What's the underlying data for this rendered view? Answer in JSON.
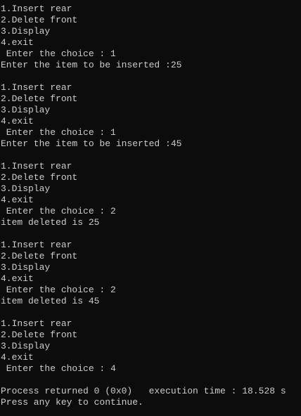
{
  "console": {
    "lines": [
      "1.Insert rear",
      "2.Delete front",
      "3.Display",
      "4.exit",
      " Enter the choice : 1",
      "Enter the item to be inserted :25",
      "",
      "1.Insert rear",
      "2.Delete front",
      "3.Display",
      "4.exit",
      " Enter the choice : 1",
      "Enter the item to be inserted :45",
      "",
      "1.Insert rear",
      "2.Delete front",
      "3.Display",
      "4.exit",
      " Enter the choice : 2",
      "item deleted is 25",
      "",
      "1.Insert rear",
      "2.Delete front",
      "3.Display",
      "4.exit",
      " Enter the choice : 2",
      "item deleted is 45",
      "",
      "1.Insert rear",
      "2.Delete front",
      "3.Display",
      "4.exit",
      " Enter the choice : 4",
      "",
      "Process returned 0 (0x0)   execution time : 18.528 s",
      "Press any key to continue."
    ]
  },
  "colors": {
    "background": "#0c0c0c",
    "foreground": "#cccccc"
  }
}
